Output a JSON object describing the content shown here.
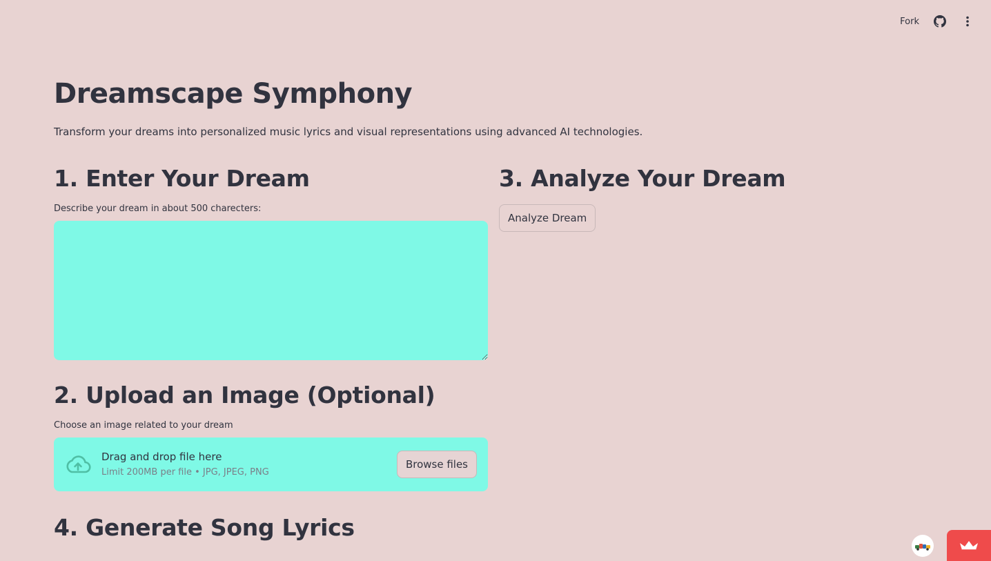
{
  "toolbar": {
    "fork_label": "Fork",
    "github_icon": "github-icon",
    "menu_icon": "kebab-menu-icon"
  },
  "page": {
    "title": "Dreamscape Symphony",
    "subtitle": "Transform your dreams into personalized music lyrics and visual representations using advanced AI technologies."
  },
  "step1": {
    "heading": "1. Enter Your Dream",
    "label": "Describe your dream in about 500 charecters:",
    "value": ""
  },
  "step2": {
    "heading": "2. Upload an Image (Optional)",
    "label": "Choose an image related to your dream",
    "drop_text": "Drag and drop file here",
    "limit_text": "Limit 200MB per file • JPG, JPEG, PNG",
    "browse_label": "Browse files",
    "icon": "cloud-upload-icon"
  },
  "step3": {
    "heading": "3. Analyze Your Dream",
    "button_label": "Analyze Dream"
  },
  "step4": {
    "heading": "4. Generate Song Lyrics"
  },
  "colors": {
    "background": "#e8d3d2",
    "input_bg": "#7ff9e6",
    "text": "#31333f",
    "badge": "#ef4b4b"
  }
}
